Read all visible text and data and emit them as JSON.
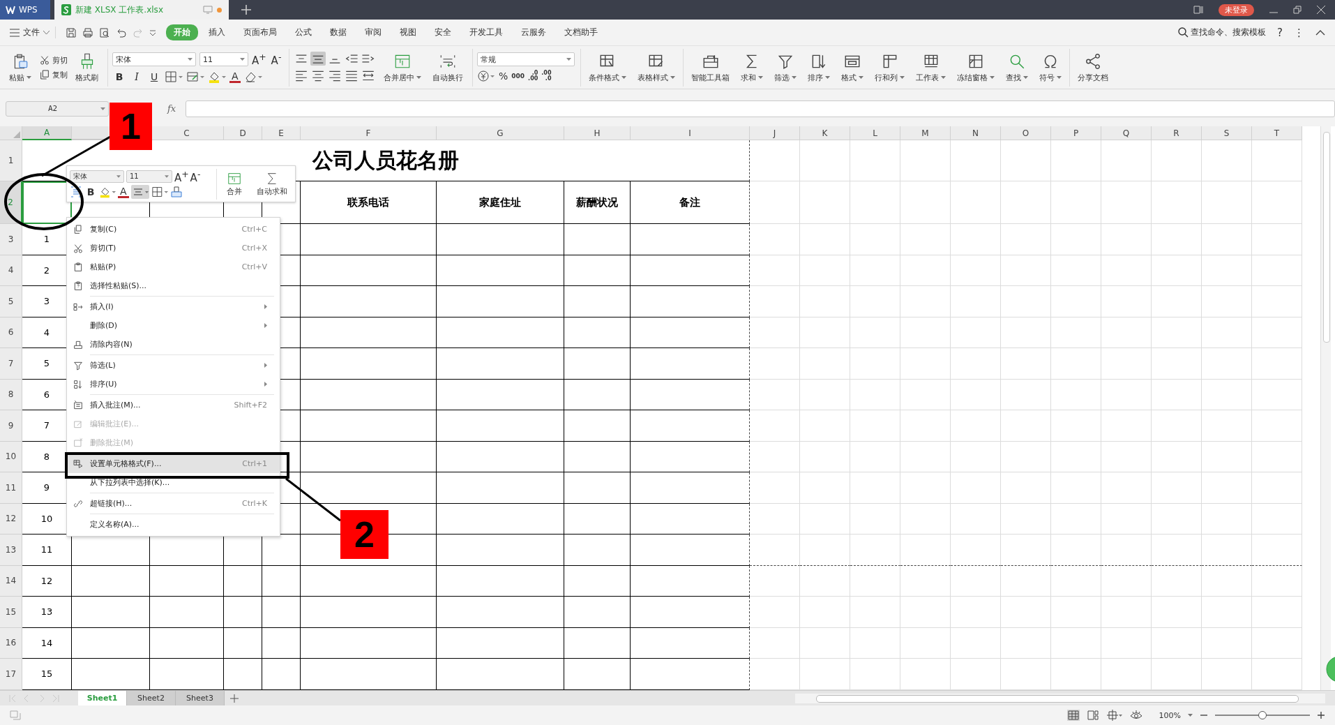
{
  "titlebar": {
    "app_tab": "WPS",
    "doc_tab": "新建 XLSX 工作表.xlsx",
    "login_badge": "未登录"
  },
  "menubar": {
    "file": "文件",
    "tabs": [
      {
        "label": "开始",
        "selected": true
      },
      {
        "label": "插入",
        "selected": false
      },
      {
        "label": "页面布局",
        "selected": false
      },
      {
        "label": "公式",
        "selected": false
      },
      {
        "label": "数据",
        "selected": false
      },
      {
        "label": "审阅",
        "selected": false
      },
      {
        "label": "视图",
        "selected": false
      },
      {
        "label": "安全",
        "selected": false
      },
      {
        "label": "开发工具",
        "selected": false
      },
      {
        "label": "云服务",
        "selected": false
      },
      {
        "label": "文档助手",
        "selected": false
      }
    ],
    "search": "查找命令、搜索模板",
    "help": "?",
    "more": "⋮"
  },
  "ribbon": {
    "paste": "粘贴",
    "cut": "剪切",
    "copy": "复制",
    "format_painter": "格式刷",
    "font": "宋体",
    "font_size": "11",
    "grow_font": "A$^{+}$",
    "shrink_font": "A$^{-}$",
    "style_buttons": [
      "B",
      "I",
      "U"
    ],
    "font_color": "A",
    "merge": "合并居中",
    "wrap": "自动换行",
    "number_format": "常规",
    "percent": "%",
    "thousands": "000",
    "decimals": [
      {
        "top": ".0",
        "bottom": ".00"
      },
      {
        "top": ".00",
        "bottom": ".0"
      }
    ],
    "buttons": [
      {
        "label": "条件格式",
        "dropdown": true
      },
      {
        "label": "表格样式",
        "dropdown": true
      },
      {
        "label": "智能工具箱",
        "dropdown": false
      },
      {
        "label": "求和",
        "dropdown": true
      },
      {
        "label": "筛选",
        "dropdown": true
      },
      {
        "label": "排序",
        "dropdown": true
      },
      {
        "label": "格式",
        "dropdown": true
      },
      {
        "label": "行和列",
        "dropdown": true
      },
      {
        "label": "工作表",
        "dropdown": true
      },
      {
        "label": "冻结窗格",
        "dropdown": true
      },
      {
        "label": "查找",
        "dropdown": true
      },
      {
        "label": "符号",
        "dropdown": true
      },
      {
        "label": "分享文档",
        "dropdown": false
      }
    ]
  },
  "formula_bar": {
    "name_box": "A2",
    "fx": "fx"
  },
  "sheet": {
    "columns": [
      {
        "label": "A",
        "selected": true
      },
      {
        "selected": false
      },
      {
        "label": "C",
        "selected": false
      },
      {
        "label": "D",
        "selected": false
      },
      {
        "label": "E",
        "selected": false
      },
      {
        "label": "F",
        "selected": false
      },
      {
        "label": "G",
        "selected": false
      },
      {
        "label": "H",
        "selected": false
      },
      {
        "label": "I",
        "selected": false
      },
      {
        "label": "J",
        "selected": false
      },
      {
        "label": "K",
        "selected": false
      },
      {
        "label": "L",
        "selected": false
      },
      {
        "label": "M",
        "selected": false
      },
      {
        "label": "N",
        "selected": false
      },
      {
        "label": "O",
        "selected": false
      },
      {
        "label": "P",
        "selected": false
      },
      {
        "label": "Q",
        "selected": false
      },
      {
        "label": "R",
        "selected": false
      },
      {
        "label": "S",
        "selected": false
      },
      {
        "label": "T",
        "selected": false
      }
    ],
    "rows": [
      {
        "label": "1",
        "selected": false
      },
      {
        "label": "2",
        "selected": true
      },
      {
        "label": "3",
        "selected": false
      },
      {
        "label": "4",
        "selected": false
      },
      {
        "label": "5",
        "selected": false
      },
      {
        "label": "6",
        "selected": false
      },
      {
        "label": "7",
        "selected": false
      },
      {
        "label": "8",
        "selected": false
      },
      {
        "label": "9",
        "selected": false
      },
      {
        "label": "10",
        "selected": false
      },
      {
        "label": "11",
        "selected": false
      },
      {
        "label": "12",
        "selected": false
      },
      {
        "label": "13",
        "selected": false
      },
      {
        "label": "14",
        "selected": false
      },
      {
        "label": "15",
        "selected": false
      },
      {
        "label": "16",
        "selected": false
      },
      {
        "label": "17",
        "selected": false
      }
    ],
    "title": "公司人员花名册",
    "header_cells": [
      "联系电话",
      "家庭住址",
      "薪酬状况",
      "备注"
    ],
    "serial_numbers": [
      "1",
      "2",
      "3",
      "4",
      "5",
      "6",
      "7",
      "8",
      "9",
      "10",
      "11",
      "12",
      "13",
      "14",
      "15"
    ]
  },
  "mini_toolbar": {
    "font": "宋体",
    "font_size": "11",
    "grow_font": "A$^{+}$",
    "shrink_font": "A$^{-}$",
    "bold": "B",
    "font_color": "A",
    "merge": "合并",
    "autosum": "自动求和"
  },
  "context_menu": [
    [
      {
        "label": "复制(C)",
        "shortcut": "Ctrl+C",
        "submenu": false,
        "disabled": false,
        "selected": false
      },
      {
        "label": "剪切(T)",
        "shortcut": "Ctrl+X",
        "submenu": false,
        "disabled": false,
        "selected": false
      },
      {
        "label": "粘贴(P)",
        "shortcut": "Ctrl+V",
        "submenu": false,
        "disabled": false,
        "selected": false
      },
      {
        "label": "选择性粘贴(S)...",
        "submenu": false,
        "disabled": false,
        "selected": false
      }
    ],
    [
      {
        "label": "插入(I)",
        "submenu": true,
        "disabled": false,
        "selected": false
      },
      {
        "label": "删除(D)",
        "submenu": true,
        "disabled": false,
        "selected": false
      },
      {
        "label": "清除内容(N)",
        "submenu": false,
        "disabled": false,
        "selected": false
      }
    ],
    [
      {
        "label": "筛选(L)",
        "submenu": true,
        "disabled": false,
        "selected": false
      },
      {
        "label": "排序(U)",
        "submenu": true,
        "disabled": false,
        "selected": false
      }
    ],
    [
      {
        "label": "插入批注(M)...",
        "shortcut": "Shift+F2",
        "submenu": false,
        "disabled": false,
        "selected": false
      },
      {
        "label": "编辑批注(E)...",
        "submenu": false,
        "disabled": true,
        "selected": false
      },
      {
        "label": "删除批注(M)",
        "submenu": false,
        "disabled": true,
        "selected": false
      }
    ],
    [
      {
        "label": "设置单元格格式(F)...",
        "shortcut": "Ctrl+1",
        "submenu": false,
        "disabled": false,
        "selected": true
      },
      {
        "label": "从下拉列表中选择(K)...",
        "submenu": false,
        "disabled": false,
        "selected": false
      }
    ],
    [
      {
        "label": "超链接(H)...",
        "shortcut": "Ctrl+K",
        "submenu": false,
        "disabled": false,
        "selected": false
      }
    ],
    [
      {
        "label": "定义名称(A)...",
        "submenu": false,
        "disabled": false,
        "selected": false
      }
    ]
  ],
  "sheet_tabs": [
    {
      "label": "Sheet1",
      "selected": true
    },
    {
      "label": "Sheet2",
      "selected": false
    },
    {
      "label": "Sheet3",
      "selected": false
    }
  ],
  "status_bar": {
    "zoom": "100%",
    "zoom_slider": {
      "level": 0.5
    }
  },
  "annotations": [
    {
      "label": "1"
    },
    {
      "label": "2"
    }
  ]
}
